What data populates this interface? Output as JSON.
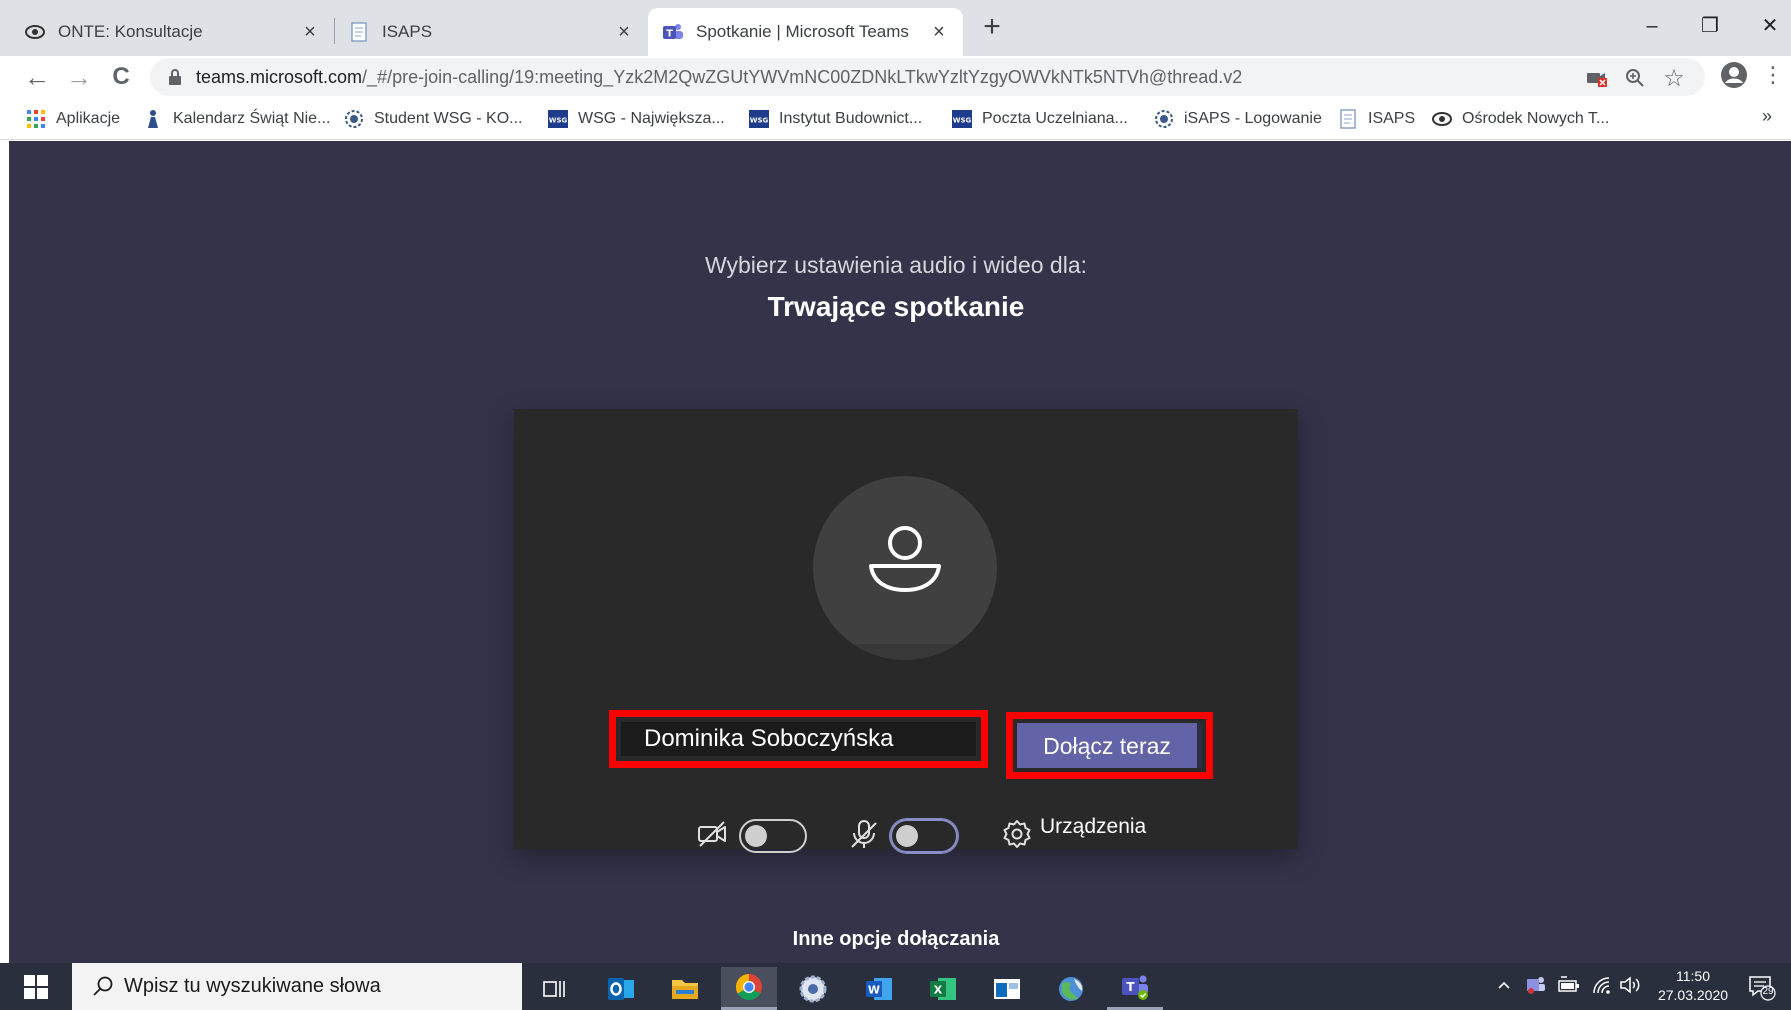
{
  "browser": {
    "tabs": [
      {
        "title": "ONTE: Konsultacje",
        "close": "×"
      },
      {
        "title": "ISAPS",
        "close": "×"
      },
      {
        "title": "Spotkanie | Microsoft Teams",
        "close": "×"
      }
    ],
    "new_tab": "+",
    "window_controls": {
      "minimize": "–",
      "restore": "❐",
      "close": "✕"
    },
    "nav": {
      "back": "←",
      "forward": "→",
      "reload": "C"
    },
    "url_host": "teams.microsoft.com",
    "url_path": "/_#/pre-join-calling/19:meeting_Yzk2M2QwZGUtYWVmNC00ZDNkLTkwYzltYzgyOWVkNTk5NTVh@thread.v2",
    "bookmarks": [
      "Aplikacje",
      "Kalendarz Świąt Nie...",
      "Student WSG - KO...",
      "WSG - Największa...",
      "Instytut Budownict...",
      "Poczta Uczelniana...",
      "iSAPS - Logowanie",
      "ISAPS",
      "Ośrodek Nowych T..."
    ],
    "bookmarks_more": "»",
    "menu": "⋮"
  },
  "teams": {
    "prompt": "Wybierz ustawienia audio i wideo dla:",
    "meeting_title": "Trwające spotkanie",
    "name_value": "Dominika Soboczyńska",
    "join_label": "Dołącz teraz",
    "devices_label": "Urządzenia",
    "other_options": "Inne opcje dołączania",
    "camera_on": false,
    "mic_on": false
  },
  "taskbar": {
    "search_placeholder": "Wpisz tu wyszukiwane słowa",
    "time": "11:50",
    "date": "27.03.2020",
    "notifications": "29"
  },
  "colors": {
    "teams_bg": "#33344a",
    "card_bg": "#292929",
    "accent": "#6264a7",
    "highlight": "#ff0000"
  }
}
